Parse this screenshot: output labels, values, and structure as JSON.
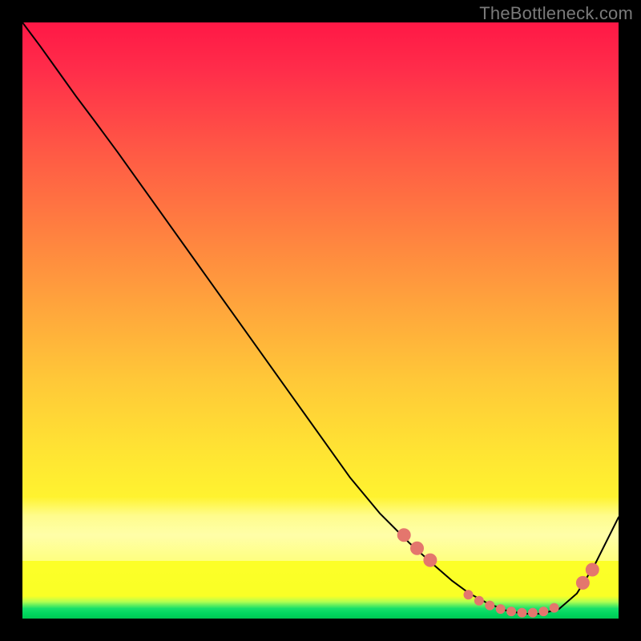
{
  "attribution": "TheBottleneck.com",
  "colors": {
    "gradient_top": "#ff1846",
    "gradient_mid": "#ffe433",
    "gradient_bottom": "#f8ff24",
    "green_strip": "#00d65e",
    "curve": "#000000",
    "dot": "#e4766d",
    "frame": "#000000"
  },
  "chart_data": {
    "type": "line",
    "title": "",
    "xlabel": "",
    "ylabel": "",
    "xlim": [
      0,
      1
    ],
    "ylim": [
      0,
      1
    ],
    "note": "Axis units are normalized 0–1 within the plot area; no tick labels are shown in the source image.",
    "series": [
      {
        "name": "curve",
        "points": [
          {
            "x": 0.0,
            "y": 1.0
          },
          {
            "x": 0.03,
            "y": 0.96
          },
          {
            "x": 0.06,
            "y": 0.918
          },
          {
            "x": 0.09,
            "y": 0.876
          },
          {
            "x": 0.12,
            "y": 0.836
          },
          {
            "x": 0.16,
            "y": 0.782
          },
          {
            "x": 0.2,
            "y": 0.726
          },
          {
            "x": 0.25,
            "y": 0.656
          },
          {
            "x": 0.3,
            "y": 0.586
          },
          {
            "x": 0.35,
            "y": 0.516
          },
          {
            "x": 0.4,
            "y": 0.446
          },
          {
            "x": 0.45,
            "y": 0.376
          },
          {
            "x": 0.5,
            "y": 0.306
          },
          {
            "x": 0.55,
            "y": 0.236
          },
          {
            "x": 0.6,
            "y": 0.176
          },
          {
            "x": 0.65,
            "y": 0.126
          },
          {
            "x": 0.69,
            "y": 0.09
          },
          {
            "x": 0.72,
            "y": 0.064
          },
          {
            "x": 0.75,
            "y": 0.042
          },
          {
            "x": 0.78,
            "y": 0.026
          },
          {
            "x": 0.81,
            "y": 0.014
          },
          {
            "x": 0.84,
            "y": 0.008
          },
          {
            "x": 0.87,
            "y": 0.008
          },
          {
            "x": 0.9,
            "y": 0.016
          },
          {
            "x": 0.93,
            "y": 0.042
          },
          {
            "x": 0.96,
            "y": 0.09
          },
          {
            "x": 1.0,
            "y": 0.17
          }
        ]
      }
    ],
    "markers": [
      {
        "x": 0.64,
        "y": 0.14,
        "size": "big"
      },
      {
        "x": 0.662,
        "y": 0.118,
        "size": "big"
      },
      {
        "x": 0.684,
        "y": 0.098,
        "size": "big"
      },
      {
        "x": 0.748,
        "y": 0.04,
        "size": "small"
      },
      {
        "x": 0.766,
        "y": 0.03,
        "size": "small"
      },
      {
        "x": 0.784,
        "y": 0.022,
        "size": "small"
      },
      {
        "x": 0.802,
        "y": 0.016,
        "size": "small"
      },
      {
        "x": 0.82,
        "y": 0.012,
        "size": "small"
      },
      {
        "x": 0.838,
        "y": 0.01,
        "size": "small"
      },
      {
        "x": 0.856,
        "y": 0.01,
        "size": "small"
      },
      {
        "x": 0.874,
        "y": 0.012,
        "size": "small"
      },
      {
        "x": 0.892,
        "y": 0.018,
        "size": "small"
      },
      {
        "x": 0.94,
        "y": 0.06,
        "size": "big"
      },
      {
        "x": 0.956,
        "y": 0.082,
        "size": "big"
      }
    ],
    "bands": [
      {
        "name": "pale-yellow",
        "y_from": 0.094,
        "y_to": 0.205
      },
      {
        "name": "green",
        "y_from": 0.0,
        "y_to": 0.038
      }
    ]
  }
}
